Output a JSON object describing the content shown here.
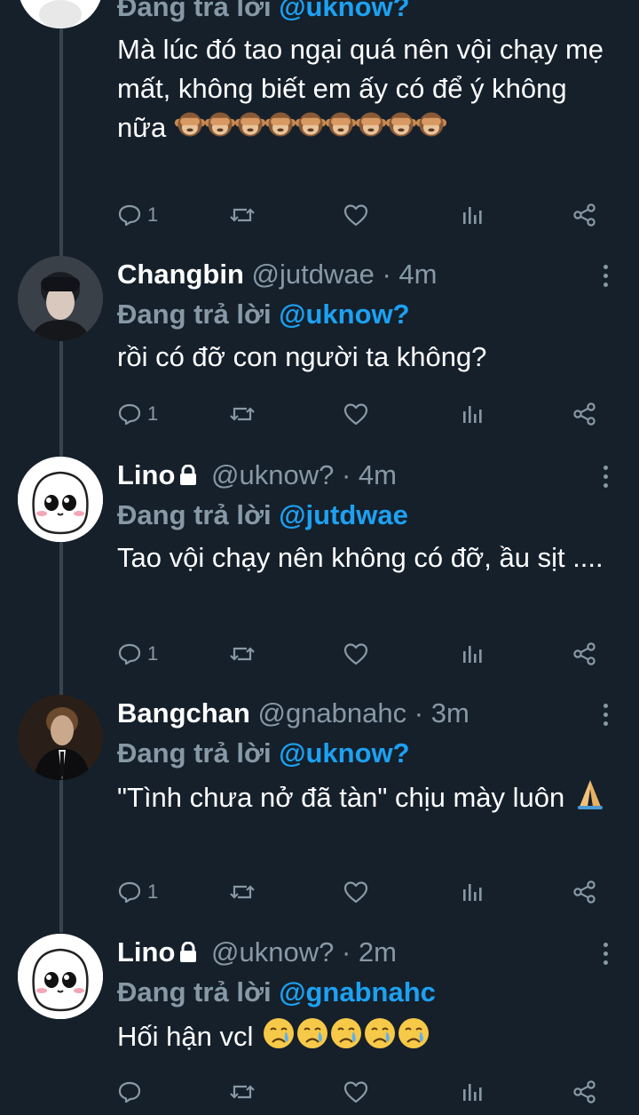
{
  "tweets": [
    {
      "display_name": "",
      "handle": "",
      "time": "",
      "reply_prefix": "Đang trả lời",
      "reply_to": "@uknow?",
      "text": "Mà lúc đó tao ngại quá nên vội chạy mẹ mất, không biết em ấy có để ý không nữa",
      "emoji": [
        "see-no-evil-monkey",
        "see-no-evil-monkey",
        "see-no-evil-monkey",
        "see-no-evil-monkey",
        "see-no-evil-monkey",
        "see-no-evil-monkey",
        "see-no-evil-monkey",
        "see-no-evil-monkey",
        "see-no-evil-monkey"
      ],
      "reply_count": "1",
      "locked": true
    },
    {
      "display_name": "Changbin",
      "handle": "@jutdwae",
      "time": "· 4m",
      "reply_prefix": "Đang trả lời",
      "reply_to": "@uknow?",
      "text": "rồi có đỡ con người ta không?",
      "reply_count": "1",
      "locked": false
    },
    {
      "display_name": "Lino",
      "handle": "@uknow?",
      "time": "· 4m",
      "reply_prefix": "Đang trả lời",
      "reply_to": "@jutdwae",
      "text": "Tao vội chạy nên không có đỡ, ầu sịt ....",
      "reply_count": "1",
      "locked": true
    },
    {
      "display_name": "Bangchan",
      "handle": "@gnabnahc",
      "time": "· 3m",
      "reply_prefix": "Đang trả lời",
      "reply_to": "@uknow?",
      "text": "\"Tình chưa nở đã tàn\" chịu mày luôn",
      "emoji": [
        "folded-hands"
      ],
      "reply_count": "1",
      "locked": false
    },
    {
      "display_name": "Lino",
      "handle": "@uknow?",
      "time": "· 2m",
      "reply_prefix": "Đang trả lời",
      "reply_to": "@gnabnahc",
      "text": "Hối hận vcl",
      "emoji": [
        "crying-face",
        "crying-face",
        "crying-face",
        "crying-face",
        "crying-face"
      ],
      "reply_count": "",
      "locked": true
    }
  ],
  "colors": {
    "background": "#15202b",
    "text": "#ffffff",
    "muted": "#8899a6",
    "mention": "#1da1f2",
    "thread_line": "#38444d"
  },
  "icons": [
    "reply-icon",
    "retweet-icon",
    "like-icon",
    "analytics-icon",
    "share-icon",
    "more-icon",
    "lock-icon"
  ]
}
